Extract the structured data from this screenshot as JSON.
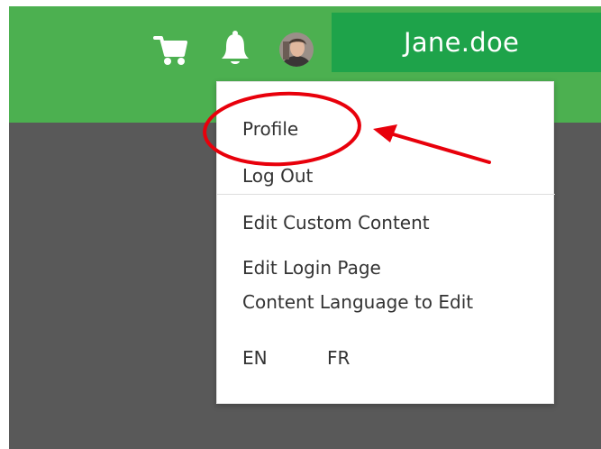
{
  "header": {
    "username": "Jane.doe",
    "icons": [
      "cart-icon",
      "bell-icon",
      "avatar"
    ]
  },
  "menu": {
    "profile": "Profile",
    "logout": "Log Out",
    "edit_custom_content": "Edit Custom Content",
    "edit_login_page": "Edit Login Page",
    "content_language": "Content Language to Edit",
    "lang_en": "EN",
    "lang_fr": "FR"
  },
  "colors": {
    "header": "#4cb050",
    "user_tab": "#1ea34a",
    "content_bg": "#595959",
    "annotation": "#e8000b"
  }
}
